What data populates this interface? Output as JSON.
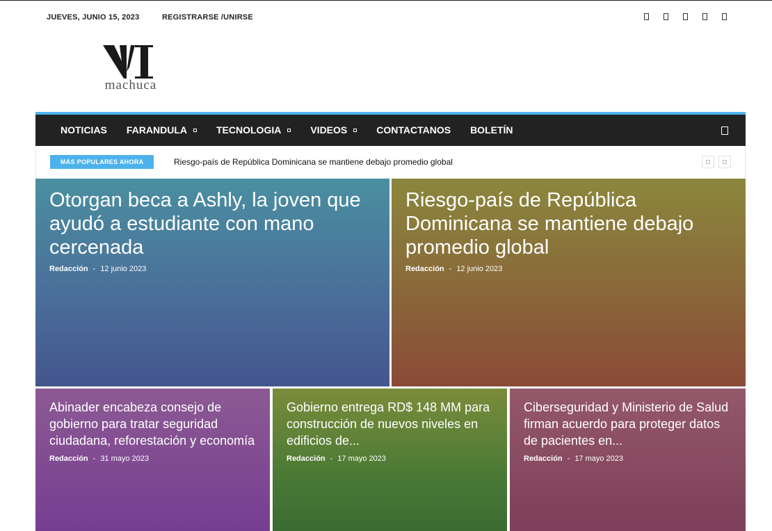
{
  "topbar": {
    "date": "JUEVES, JUNIO 15, 2023",
    "register": "REGISTRARSE /UNIRSE",
    "social_icons": [
      "facebook-icon",
      "instagram-icon",
      "twitter-icon",
      "vimeo-icon",
      "youtube-icon"
    ]
  },
  "logo": {
    "wordmark": "machuca"
  },
  "nav": {
    "items": [
      {
        "label": "NOTICIAS",
        "has_dropdown": false
      },
      {
        "label": "FARANDULA",
        "has_dropdown": true
      },
      {
        "label": "TECNOLOGIA",
        "has_dropdown": true
      },
      {
        "label": "VIDEOS",
        "has_dropdown": true
      },
      {
        "label": "CONTACTANOS",
        "has_dropdown": false
      },
      {
        "label": "BOLETÍN",
        "has_dropdown": false
      }
    ],
    "search_icon": "search-icon",
    "accent_color": "#4db2ec"
  },
  "ticker": {
    "badge": "MÁS POPULARES AHORA",
    "headline": "Riesgo-país de República Dominicana se mantiene debajo promedio global"
  },
  "featured": [
    {
      "title": "Otorgan beca a Ashly, la joven que ayudó a estudiante con mano cercenada",
      "author": "Redacción",
      "date": "12 junio 2023"
    },
    {
      "title": "Riesgo-país de República Dominicana se mantiene debajo promedio global",
      "author": "Redacción",
      "date": "12 junio 2023"
    },
    {
      "title": "Abinader encabeza consejo de gobierno para tratar seguridad ciudadana, reforestación y economía",
      "author": "Redacción",
      "date": "31 mayo 2023"
    },
    {
      "title": "Gobierno entrega RD$ 148 MM para construcción de nuevos niveles en edificios de...",
      "author": "Redacción",
      "date": "17 mayo 2023"
    },
    {
      "title": "Ciberseguridad y Ministerio de Salud firman acuerdo para proteger datos de pacientes en...",
      "author": "Redacción",
      "date": "17 mayo 2023"
    }
  ],
  "meta_separator": "-"
}
